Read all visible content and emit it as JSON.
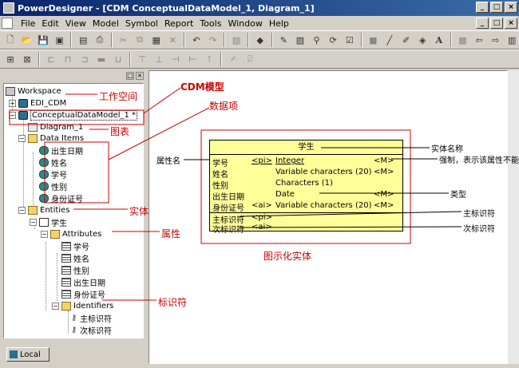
{
  "window": {
    "title": "PowerDesigner - [CDM ConceptualDataModel_1, Diagram_1]",
    "buttons": [
      "_",
      "□",
      "×"
    ]
  },
  "menu": [
    "File",
    "Edit",
    "View",
    "Model",
    "Symbol",
    "Report",
    "Tools",
    "Window",
    "Help"
  ],
  "browser": {
    "workspace": "Workspace",
    "edi_cdm": "EDI_CDM",
    "model": "ConceptualDataModel_1 *",
    "diagram": "Diagram_1",
    "data_items_folder": "Data Items",
    "data_items": [
      "出生日期",
      "姓名",
      "学号",
      "性别",
      "身份证号"
    ],
    "entities_folder": "Entities",
    "entity": "学生",
    "attributes_folder": "Attributes",
    "attributes": [
      "学号",
      "姓名",
      "性别",
      "出生日期",
      "身份证号"
    ],
    "identifiers_folder": "Identifiers",
    "identifiers": [
      "主标识符",
      "次标识符"
    ],
    "local_tab": "Local"
  },
  "annotations": {
    "cdm_model": "CDM模型",
    "workspace": "工作空间",
    "data_item": "数据项",
    "diagram": "图表",
    "entity": "实体",
    "attribute": "属性",
    "identifier": "标识符",
    "graphic_entity": "图示化实体",
    "attr_name": "属性名",
    "entity_name": "实体名称",
    "mandatory": "强制，表示该属性不能",
    "type": "类型",
    "primary_id": "主标识符",
    "secondary_id": "次标识符"
  },
  "entity_box": {
    "title": "学生",
    "rows": [
      {
        "name": "学号",
        "key": "<pi>",
        "type": "Integer",
        "flag": "<M>"
      },
      {
        "name": "姓名",
        "key": "",
        "type": "Variable characters (20)",
        "flag": "<M>"
      },
      {
        "name": "性别",
        "key": "",
        "type": "Characters (1)",
        "flag": ""
      },
      {
        "name": "出生日期",
        "key": "",
        "type": "Date",
        "flag": "<M>"
      },
      {
        "name": "身份证号",
        "key": "<ai>",
        "type": "Variable characters (20)",
        "flag": "<M>"
      }
    ],
    "identifiers": [
      {
        "name": "主标识符",
        "key": "<pi>"
      },
      {
        "name": "次标识符",
        "key": "<ai>"
      }
    ]
  },
  "colors": {
    "annotation": "#cc0000",
    "entity_fill": "#ffff99",
    "titlebar": "#0a246a"
  }
}
